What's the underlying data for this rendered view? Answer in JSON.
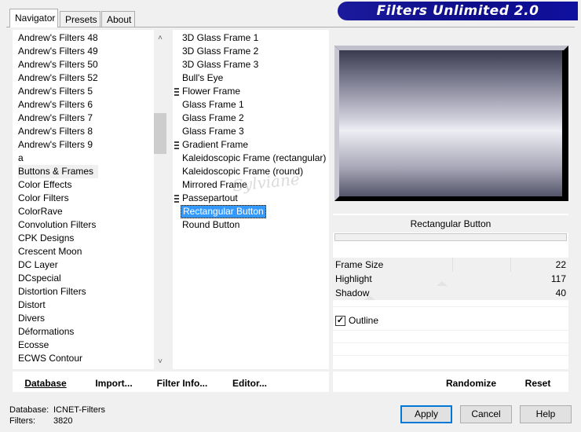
{
  "banner": {
    "title": "Filters Unlimited 2.0"
  },
  "tabs": [
    {
      "label": "Navigator",
      "active": true
    },
    {
      "label": "Presets",
      "active": false
    },
    {
      "label": "About",
      "active": false
    }
  ],
  "categories": {
    "items": [
      "Andrew's Filters 48",
      "Andrew's Filters 49",
      "Andrew's Filters 50",
      "Andrew's Filters 52",
      "Andrew's Filters 5",
      "Andrew's Filters 6",
      "Andrew's Filters 7",
      "Andrew's Filters 8",
      "Andrew's Filters 9",
      "a",
      "Buttons & Frames",
      "Color Effects",
      "Color Filters",
      "ColorRave",
      "Convolution Filters",
      "CPK Designs",
      "Crescent Moon",
      "DC Layer",
      "DCspecial",
      "Distortion Filters",
      "Distort",
      "Divers",
      "Déformations",
      "Ecosse",
      "ECWS Contour"
    ],
    "selected": "Buttons & Frames",
    "scroll_up_icon": "chevron-up-icon",
    "scroll_down_icon": "chevron-down-icon"
  },
  "filters": {
    "items": [
      {
        "label": "3D Glass Frame 1",
        "group": false
      },
      {
        "label": "3D Glass Frame 2",
        "group": false
      },
      {
        "label": "3D Glass Frame 3",
        "group": false
      },
      {
        "label": "Bull's Eye",
        "group": false
      },
      {
        "label": "Flower Frame",
        "group": true
      },
      {
        "label": "Glass Frame 1",
        "group": false
      },
      {
        "label": "Glass Frame 2",
        "group": false
      },
      {
        "label": "Glass Frame 3",
        "group": false
      },
      {
        "label": "Gradient Frame",
        "group": true
      },
      {
        "label": "Kaleidoscopic Frame (rectangular)",
        "group": false
      },
      {
        "label": "Kaleidoscopic Frame (round)",
        "group": false
      },
      {
        "label": "Mirrored Frame",
        "group": false
      },
      {
        "label": "Passepartout",
        "group": true
      },
      {
        "label": "Rectangular Button",
        "group": false
      },
      {
        "label": "Round Button",
        "group": false
      }
    ],
    "selected": "Rectangular Button"
  },
  "preview": {
    "filter_name": "Rectangular Button"
  },
  "params": [
    {
      "label": "Frame Size",
      "value": "22"
    },
    {
      "label": "Highlight",
      "value": "117"
    },
    {
      "label": "Shadow",
      "value": "40"
    }
  ],
  "outline": {
    "label": "Outline",
    "checked": true
  },
  "bottom_buttons": {
    "database": "Database",
    "import": "Import...",
    "filter_info": "Filter Info...",
    "editor": "Editor...",
    "randomize": "Randomize",
    "reset": "Reset"
  },
  "status": {
    "database_label": "Database:",
    "database_value": "ICNET-Filters",
    "filters_label": "Filters:",
    "filters_value": "3820"
  },
  "dialog_buttons": {
    "apply": "Apply",
    "cancel": "Cancel",
    "help": "Help"
  },
  "watermark": "Sylviane"
}
